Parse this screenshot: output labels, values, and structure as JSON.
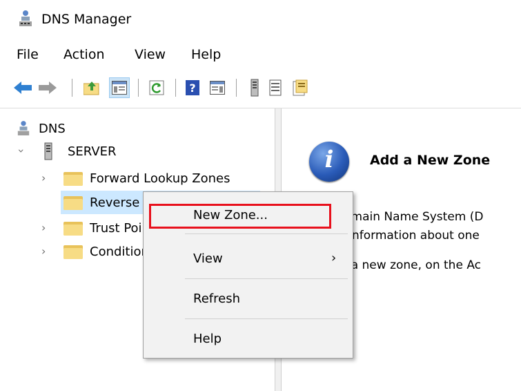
{
  "window": {
    "title": "DNS Manager",
    "icon": "dns-server-icon"
  },
  "menu": [
    "File",
    "Action",
    "View",
    "Help"
  ],
  "toolbar": {
    "icons": [
      "back-arrow-icon",
      "forward-arrow-icon",
      "up-folder-icon",
      "show-hide-tree-icon",
      "refresh-icon",
      "help-icon",
      "properties-icon",
      "server-icon",
      "list-icon",
      "new-item-icon"
    ]
  },
  "tree": {
    "root": "DNS",
    "server": "SERVER",
    "items": [
      {
        "label": "Forward Lookup Zones"
      },
      {
        "label": "Reverse Lookup Zones"
      },
      {
        "label": "Trust Points"
      },
      {
        "label": "Conditional Forwarders"
      }
    ]
  },
  "detail": {
    "heading": "Add a New Zone",
    "line1": "The Domain Name System (D",
    "line2": "stores information about one",
    "line3": "To add a new zone, on the Ac"
  },
  "context_menu": {
    "items": [
      "New Zone...",
      "View",
      "Refresh",
      "Help"
    ],
    "highlight_color": "#e8101c"
  },
  "colors": {
    "selection": "#cce8ff",
    "menu_bg": "#f2f2f2"
  }
}
